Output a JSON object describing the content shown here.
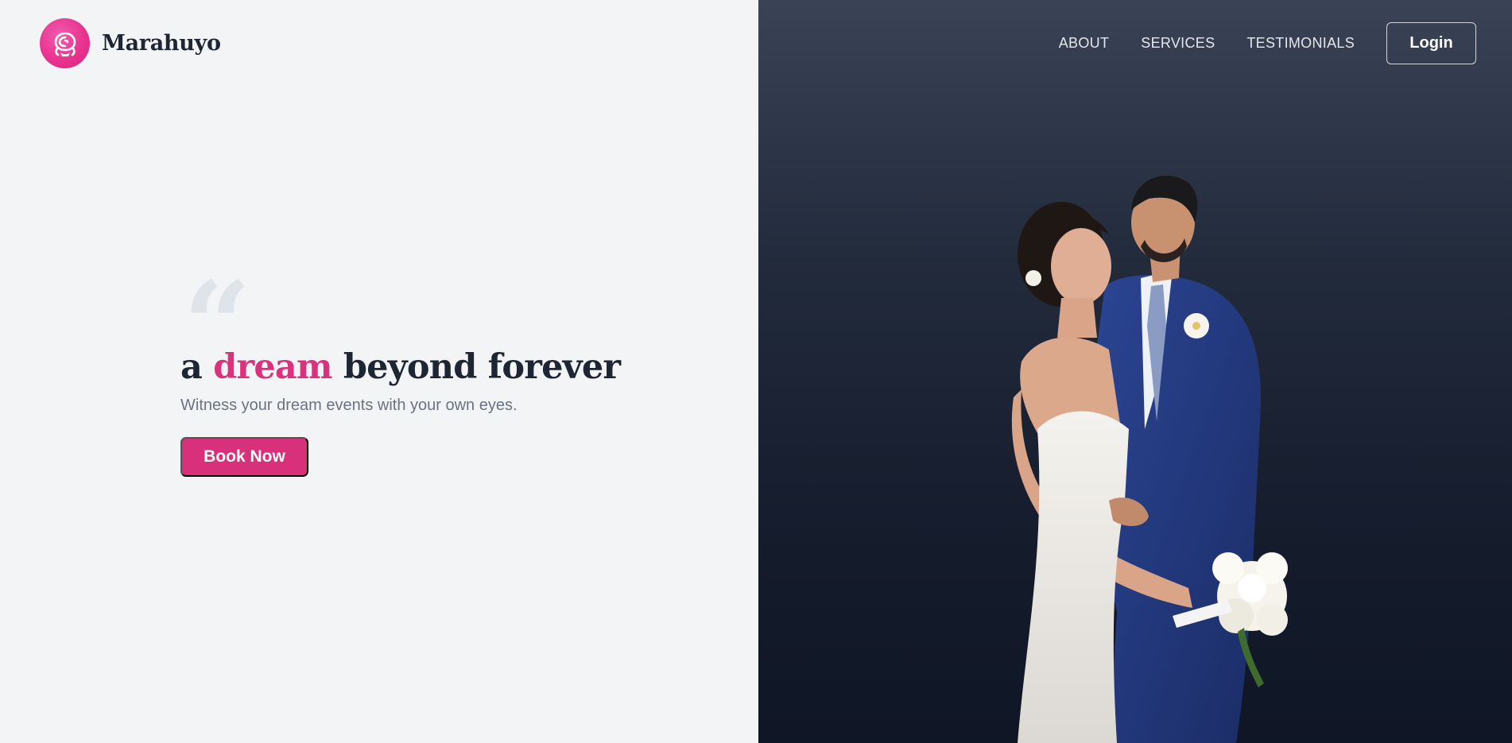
{
  "brand": {
    "name": "Marahuyo",
    "logo_icon": "rose-icon",
    "accent": "#e8338f"
  },
  "nav": {
    "links": [
      {
        "label": "ABOUT"
      },
      {
        "label": "SERVICES"
      },
      {
        "label": "TESTIMONIALS"
      }
    ],
    "login_label": "Login"
  },
  "hero": {
    "quote_icon": "quote-icon",
    "headline_before": "a ",
    "headline_accent": "dream",
    "headline_after": " beyond forever",
    "subtitle": "Witness your dream events with your own eyes.",
    "cta_label": "Book Now",
    "accent_color": "#d9337e"
  },
  "image": {
    "subject": "couple-photo"
  }
}
